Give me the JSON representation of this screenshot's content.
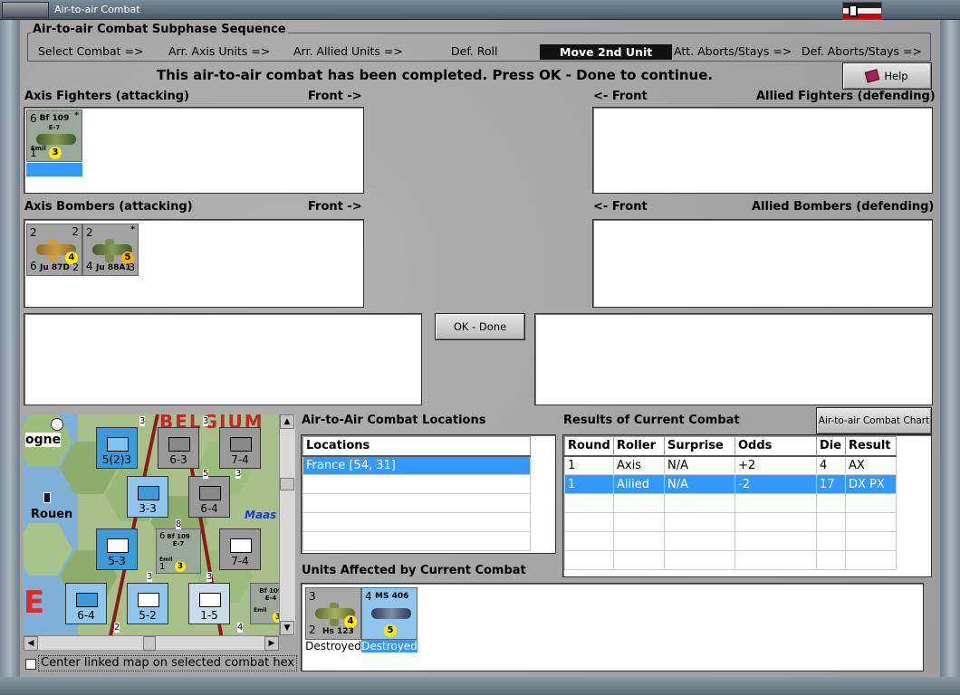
{
  "window": {
    "title": "Air-to-air Combat"
  },
  "subphase": {
    "title": "Air-to-air Combat Subphase Sequence",
    "phases": [
      "Select Combat =>",
      "Arr. Axis Units =>",
      "Arr. Allied Units =>",
      "Def. Roll",
      "Move 2nd Unit",
      "Att. Aborts/Stays =>",
      "Def. Aborts/Stays =>"
    ],
    "active_phase": "Move 2nd Unit"
  },
  "status_message": "This air-to-air combat has been completed.  Press OK - Done to continue.",
  "help_label": "Help",
  "axis_fighters": {
    "label": "Axis Fighters (attacking)",
    "front": "Front ->",
    "counters": [
      {
        "top_left": "6",
        "name": "Bf 109",
        "sub": "E-7",
        "nickname": "Emil",
        "bottom_left": "1",
        "die": "3",
        "marks": "*",
        "selected": true
      }
    ]
  },
  "allied_fighters": {
    "label": "Allied Fighters (defending)",
    "front": "<- Front"
  },
  "axis_bombers": {
    "label": "Axis Bombers (attacking)",
    "front": "Front ->",
    "counters": [
      {
        "top_left": "2",
        "top_right": "2",
        "name": "Ju 87D",
        "bottom_left": "6",
        "bottom_right": "2",
        "die": "4"
      },
      {
        "top_left": "2",
        "top_right": "*",
        "name": "Ju 88A1",
        "bottom_left": "4",
        "bottom_right": "3",
        "die": "5"
      }
    ]
  },
  "allied_bombers": {
    "label": "Allied Bombers (defending)",
    "front": "<- Front"
  },
  "ok_button": "OK - Done",
  "map": {
    "labels": {
      "city1": "ogne",
      "city2": "Rouen",
      "river": "Maas",
      "region": "E",
      "country": "BELGIUM"
    },
    "counters": [
      {
        "type": "XXXXX",
        "value": "5(2)3",
        "side": "allied"
      },
      {
        "type": "XXX",
        "value": "6-3",
        "side": "axis"
      },
      {
        "type": "XXX",
        "value": "7-4",
        "side": "axis"
      },
      {
        "type": "XXX",
        "value": "3-3",
        "side": "allied"
      },
      {
        "type": "XXX",
        "value": "6-4",
        "side": "axis"
      },
      {
        "type": "XXX",
        "value": "5-3",
        "side": "allied"
      },
      {
        "type": "XXX",
        "value": "7-4",
        "side": "axis"
      },
      {
        "type": "XXX",
        "value": "6-4",
        "side": "allied"
      },
      {
        "type": "XXX",
        "value": "5-2",
        "side": "allied"
      },
      {
        "type": "XX",
        "value": "1-5",
        "side": "allied"
      }
    ],
    "air_counter": {
      "top_left": "6",
      "name": "Bf 109",
      "sub": "E-7",
      "nickname": "Emil",
      "bottom_left": "1",
      "die": "3"
    },
    "small_numbers": [
      "3",
      "3",
      "5",
      "3",
      "8",
      "3",
      "3",
      "2",
      "4"
    ],
    "corner_counter": {
      "name": "Bf 109",
      "sub": "E-4",
      "nickname": "Emil",
      "die": "3"
    }
  },
  "center_checkbox": {
    "label": "Center linked map on selected combat hex",
    "checked": false
  },
  "locations": {
    "title": "Air-to-Air Combat Locations",
    "header": "Locations",
    "rows": [
      "France [54, 31]"
    ]
  },
  "results": {
    "title": "Results of Current Combat",
    "chart_button": "Air-to-air Combat Chart",
    "columns": [
      "Round",
      "Roller",
      "Surprise",
      "Odds",
      "Die",
      "Result"
    ],
    "rows": [
      [
        "1",
        "Axis",
        "N/A",
        "+2",
        "4",
        "AX"
      ],
      [
        "1",
        "Allied",
        "N/A",
        "-2",
        "17",
        "DX PX"
      ]
    ],
    "selected_row": 1
  },
  "affected": {
    "title": "Units Affected by Current Combat",
    "units": [
      {
        "top_left": "3",
        "name": "Hs 123",
        "bottom_left": "2",
        "die": "4",
        "status": "Destroyed",
        "selected": false
      },
      {
        "top_left": "4",
        "name": "MS 406",
        "die": "5",
        "status": "Destroyed",
        "selected": true
      }
    ]
  },
  "colors": {
    "allied_counter": "#3a9bd8",
    "axis_counter": "#9a9a9a",
    "selection": "#3399ff"
  }
}
